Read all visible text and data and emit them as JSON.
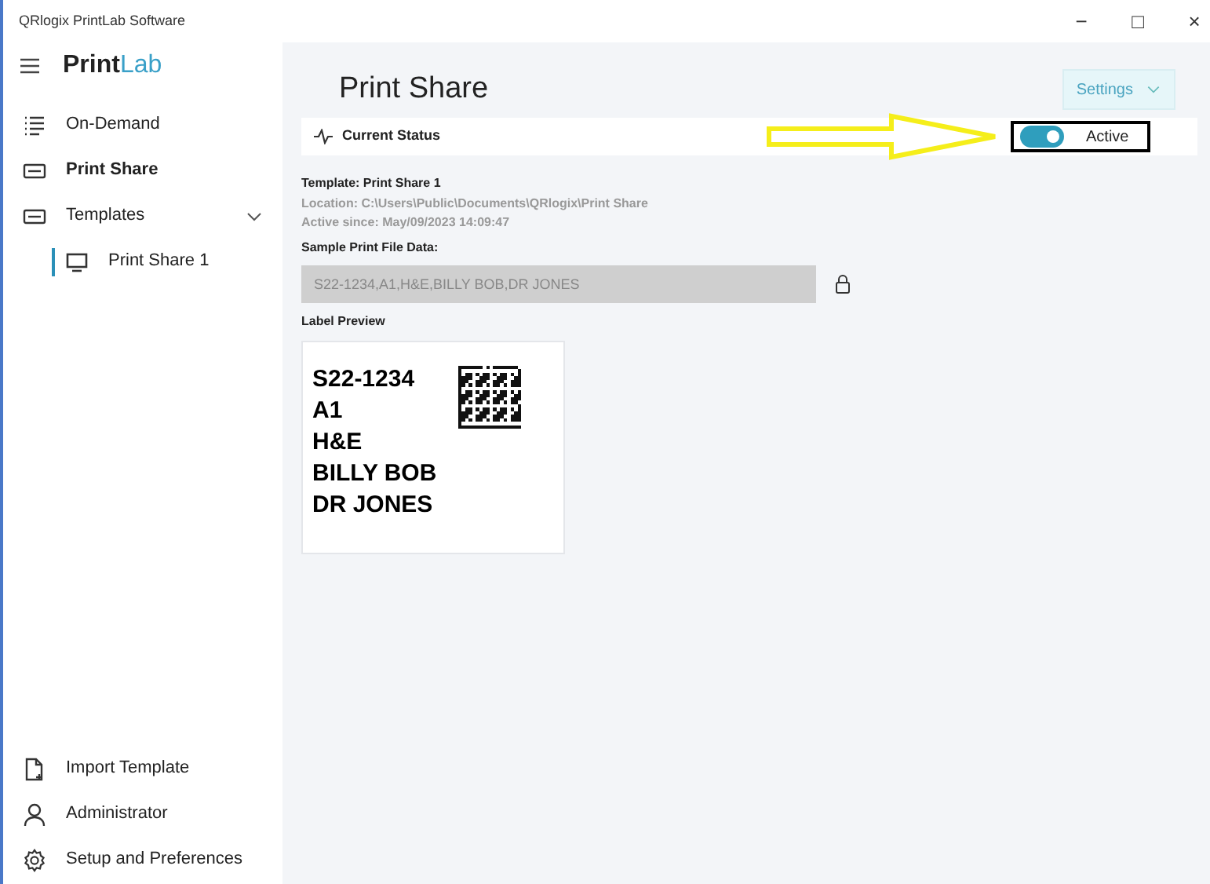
{
  "window": {
    "title": "QRlogix PrintLab Software",
    "controls": [
      "−",
      "□",
      "×"
    ]
  },
  "logo": {
    "first": "Print",
    "second": "Lab"
  },
  "sidebar": {
    "items": [
      {
        "kind": "list",
        "label": "On-Demand",
        "selected": false
      },
      {
        "kind": "card",
        "label": "Print Share",
        "selected": true
      },
      {
        "kind": "card",
        "label": "Templates",
        "selected": false,
        "expanded": true,
        "children": [
          {
            "kind": "monitor",
            "label": "Print Share 1",
            "selected": false
          }
        ]
      }
    ],
    "bottom_items": [
      {
        "kind": "import",
        "label": "Import Template"
      },
      {
        "kind": "user",
        "label": "Administrator"
      },
      {
        "kind": "gear",
        "label": "Setup and Preferences"
      }
    ]
  },
  "page": {
    "title": "Print Share",
    "settings_button": "Settings",
    "status": {
      "label": "Current Status",
      "on": true,
      "state_label": "Active"
    },
    "template": "Template: Print Share 1",
    "location": "Location: C:\\Users\\Public\\Documents\\QRlogix\\Print Share",
    "active_since": "Active since: May/09/2023 14:09:47",
    "sample_label": "Sample Print File Data:",
    "sample_value": "S22-1234,A1,H&E,BILLY BOB,DR JONES",
    "sample_locked": true,
    "preview_label": "Label Preview",
    "preview_lines": [
      "S22-1234",
      "A1",
      "H&E",
      "BILLY BOB",
      "DR JONES"
    ]
  }
}
